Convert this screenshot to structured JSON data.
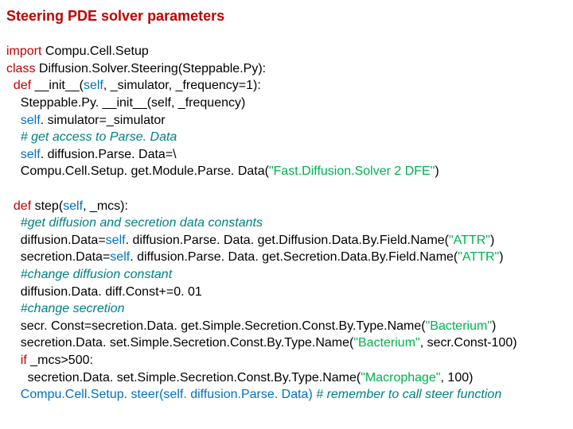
{
  "title": "Steering PDE solver parameters",
  "tokens": {
    "l1a": "import",
    "l1b": " Compu.Cell.Setup",
    "l2a": "class",
    "l2b": " Diffusion.Solver.Steering(Steppable.Py):",
    "l3a": "  def",
    "l3b": " __init__(",
    "l3c": "self",
    "l3d": ", _simulator, _frequency=1):",
    "l4": "    Steppable.Py. __init__(self, _frequency)",
    "l5a": "    ",
    "l5b": "self",
    "l5c": ". simulator=_simulator",
    "l6": "    # get access to Parse. Data",
    "l7a": "    ",
    "l7b": "self",
    "l7c": ". diffusion.Parse. Data=\\",
    "l8a": "    Compu.Cell.Setup. get.Module.Parse. Data(",
    "l8b": "\"Fast.Diffusion.Solver 2 DFE\"",
    "l8c": ")",
    "l9a": "  def",
    "l9b": " step(",
    "l9c": "self",
    "l9d": ", _mcs):",
    "l10": "    #get diffusion and secretion data constants",
    "l11a": "    diffusion.Data=",
    "l11b": "self",
    "l11c": ". diffusion.Parse. Data. get.Diffusion.Data.By.Field.Name(",
    "l11d": "\"ATTR\"",
    "l11e": ")",
    "l12a": "    secretion.Data=",
    "l12b": "self",
    "l12c": ". diffusion.Parse. Data. get.Secretion.Data.By.Field.Name(",
    "l12d": "\"ATTR\"",
    "l12e": ")",
    "l13": "    #change diffusion constant",
    "l14": "    diffusion.Data. diff.Const+=0. 01",
    "l15": "    #change secretion",
    "l16a": "    secr. Const=secretion.Data. get.Simple.Secretion.Const.By.Type.Name(",
    "l16b": "\"Bacterium\"",
    "l16c": ")",
    "l17a": "    secretion.Data. set.Simple.Secretion.Const.By.Type.Name(",
    "l17b": "\"Bacterium\"",
    "l17c": ", secr.Const-100)",
    "l18a": "    if",
    "l18b": " _mcs>500:",
    "l19a": "      secretion.Data. set.Simple.Secretion.Const.By.Type.Name(",
    "l19b": "\"Macrophage\"",
    "l19c": ", 100)",
    "l20a": "    Compu.Cell.Setup. steer(",
    "l20b": "self",
    "l20c": ". diffusion.Parse. Data)",
    "l20d": " # remember to call steer function"
  }
}
